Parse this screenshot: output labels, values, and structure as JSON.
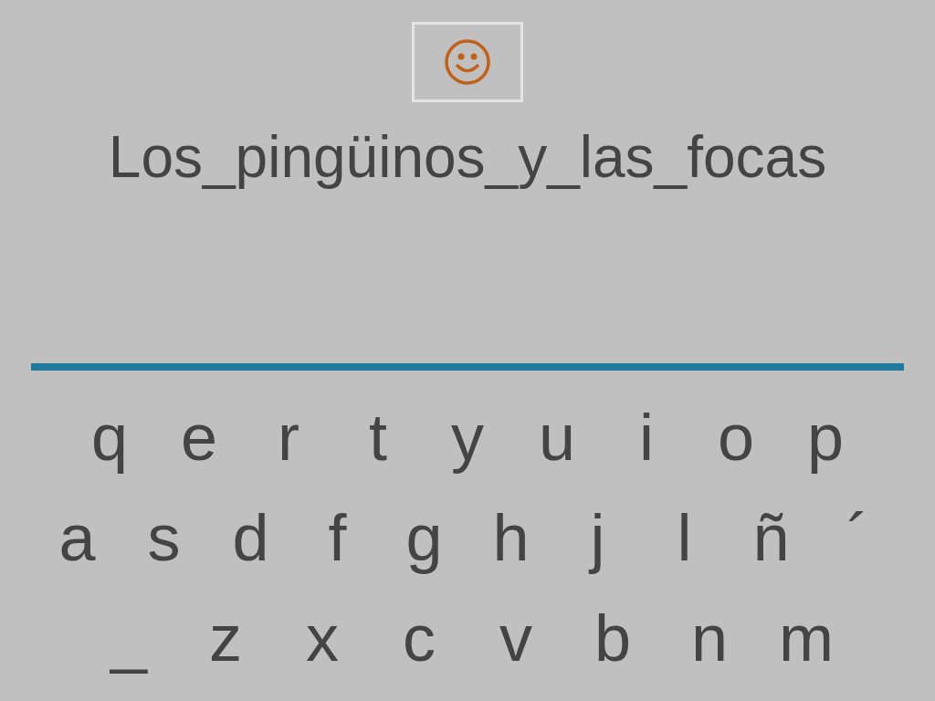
{
  "title": "Los_pingüinos_y_las_focas",
  "keyboard": [
    [
      "q",
      "e",
      "r",
      "t",
      "y",
      "u",
      "i",
      "o",
      "p"
    ],
    [
      "a",
      "s",
      "d",
      "f",
      "g",
      "h",
      "j",
      "l",
      "ñ",
      "´"
    ],
    [
      "_",
      "z",
      "x",
      "c",
      "v",
      "b",
      "n",
      "m"
    ]
  ]
}
